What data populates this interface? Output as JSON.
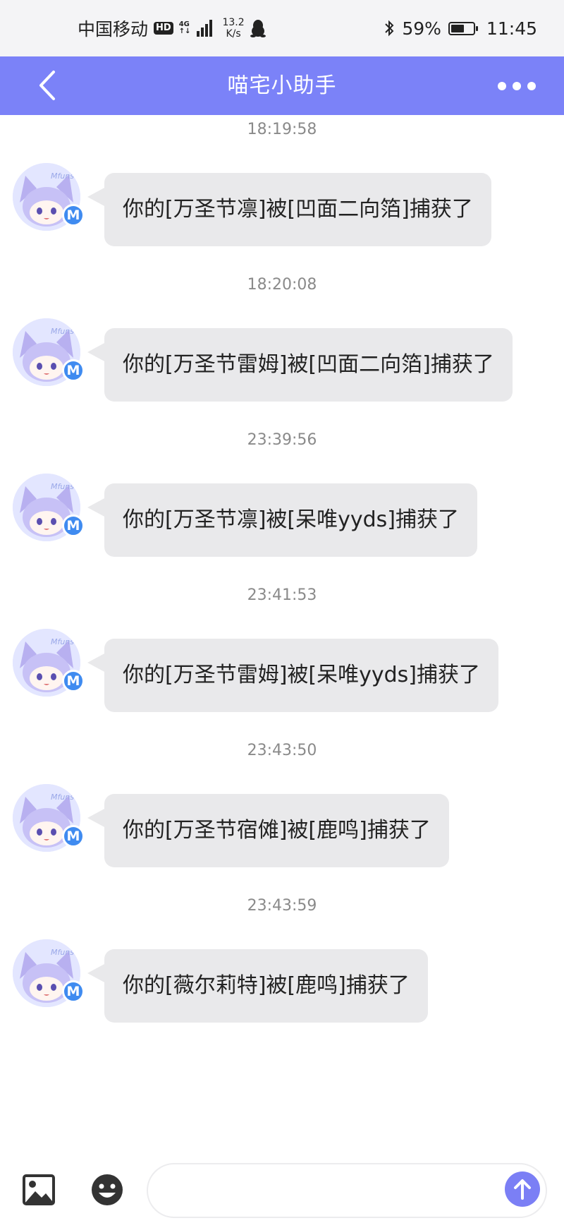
{
  "status_bar": {
    "carrier": "中国移动",
    "hd": "HD",
    "network_top": "4G",
    "network_bottom": "↑↓",
    "speed_value": "13.2",
    "speed_unit": "K/s",
    "battery_percent": "59%",
    "battery_level": 0.59,
    "time": "11:45",
    "icons": [
      "qq-penguin-icon",
      "bluetooth-icon",
      "battery-icon",
      "signal-icon"
    ]
  },
  "header": {
    "title": "喵宅小助手",
    "back_icon": "chevron-left-icon",
    "more_icon": "more-dots-icon",
    "background_color": "#7b82f8"
  },
  "messages": [
    {
      "time": "18:19:58",
      "text": "你的[万圣节凛]被[凹面二向箔]捕获了",
      "avatar_badge": "M"
    },
    {
      "time": "18:20:08",
      "text": "你的[万圣节雷姆]被[凹面二向箔]捕获了",
      "avatar_badge": "M"
    },
    {
      "time": "23:39:56",
      "text": "你的[万圣节凛]被[呆唯yyds]捕获了",
      "avatar_badge": "M"
    },
    {
      "time": "23:41:53",
      "text": "你的[万圣节雷姆]被[呆唯yyds]捕获了",
      "avatar_badge": "M"
    },
    {
      "time": "23:43:50",
      "text": "你的[万圣节宿傩]被[鹿鸣]捕获了",
      "avatar_badge": "M"
    },
    {
      "time": "23:43:59",
      "text": "你的[薇尔莉特]被[鹿鸣]捕获了",
      "avatar_badge": "M"
    }
  ],
  "avatar_caption": "Mfuns",
  "input_bar": {
    "placeholder": "",
    "image_icon": "image-icon",
    "emoji_icon": "emoji-icon",
    "send_icon": "arrow-up-icon",
    "send_color": "#7b7ff5"
  }
}
